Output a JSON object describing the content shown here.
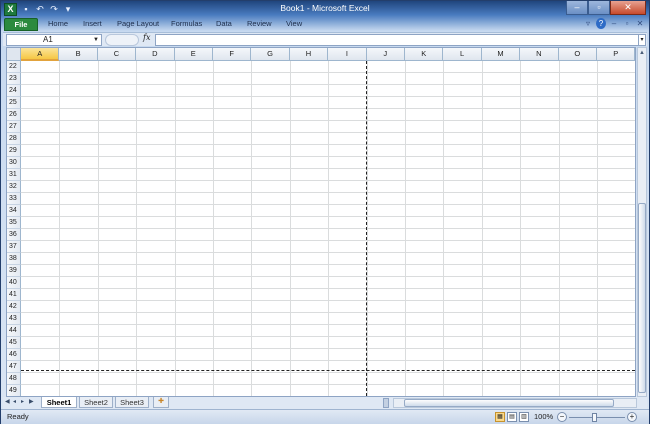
{
  "window": {
    "title": "Book1 - Microsoft Excel"
  },
  "quick_access": {
    "items": [
      "save-icon",
      "undo-icon",
      "redo-icon",
      "customize-icon"
    ]
  },
  "ribbon": {
    "file_label": "File",
    "tabs": [
      "Home",
      "Insert",
      "Page Layout",
      "Formulas",
      "Data",
      "Review",
      "View"
    ]
  },
  "formula_bar": {
    "name_box": "A1",
    "fx_label": "fx",
    "formula": ""
  },
  "grid": {
    "columns": [
      "A",
      "B",
      "C",
      "D",
      "E",
      "F",
      "G",
      "H",
      "I",
      "J",
      "K",
      "L",
      "M",
      "N",
      "O",
      "P"
    ],
    "selected_column": "A",
    "rows": [
      "22",
      "23",
      "24",
      "25",
      "26",
      "27",
      "28",
      "29",
      "30",
      "31",
      "32",
      "33",
      "34",
      "35",
      "36",
      "37",
      "38",
      "39",
      "40",
      "41",
      "42",
      "43",
      "44",
      "45",
      "46",
      "47",
      "48",
      "49"
    ]
  },
  "sheets": {
    "tabs": [
      "Sheet1",
      "Sheet2",
      "Sheet3"
    ],
    "active": "Sheet1"
  },
  "status": {
    "text": "Ready",
    "zoom": "100%"
  }
}
